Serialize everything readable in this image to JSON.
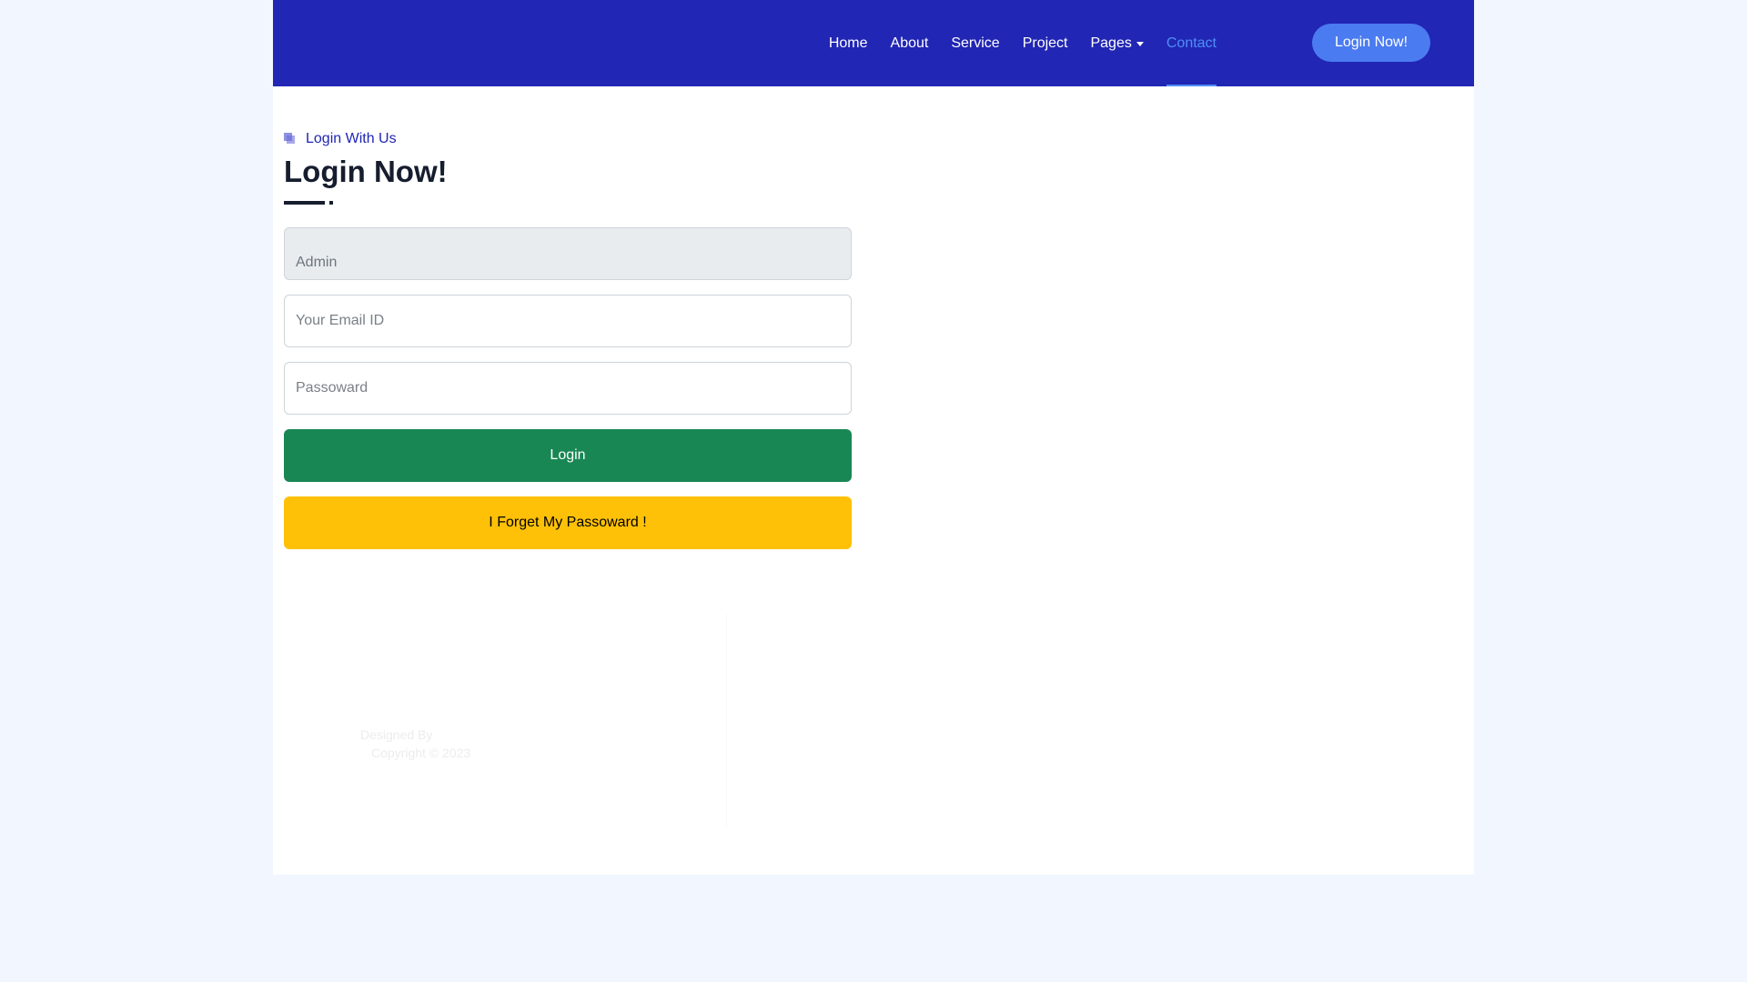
{
  "nav": {
    "items": [
      {
        "label": "Home"
      },
      {
        "label": "About"
      },
      {
        "label": "Service"
      },
      {
        "label": "Project"
      },
      {
        "label": "Pages"
      },
      {
        "label": "Contact"
      }
    ],
    "cta_label": "Login Now!",
    "active_item": "Contact"
  },
  "main": {
    "subtitle": "Login With Us",
    "title": "Login Now!"
  },
  "form": {
    "username_value": "Admin",
    "email_placeholder": "Your Email ID",
    "password_placeholder": "Passoward",
    "login_label": "Login",
    "forgot_label": "I Forget My Passoward !"
  },
  "footer": {
    "designed_by": "Designed By",
    "copyright": "Copyright © 2023"
  },
  "colors": {
    "navbar": "#2126b4",
    "accent": "#4b7bf0",
    "login_button": "#198754",
    "forgot_button": "#ffc107",
    "active_link": "#4f8ff5"
  }
}
